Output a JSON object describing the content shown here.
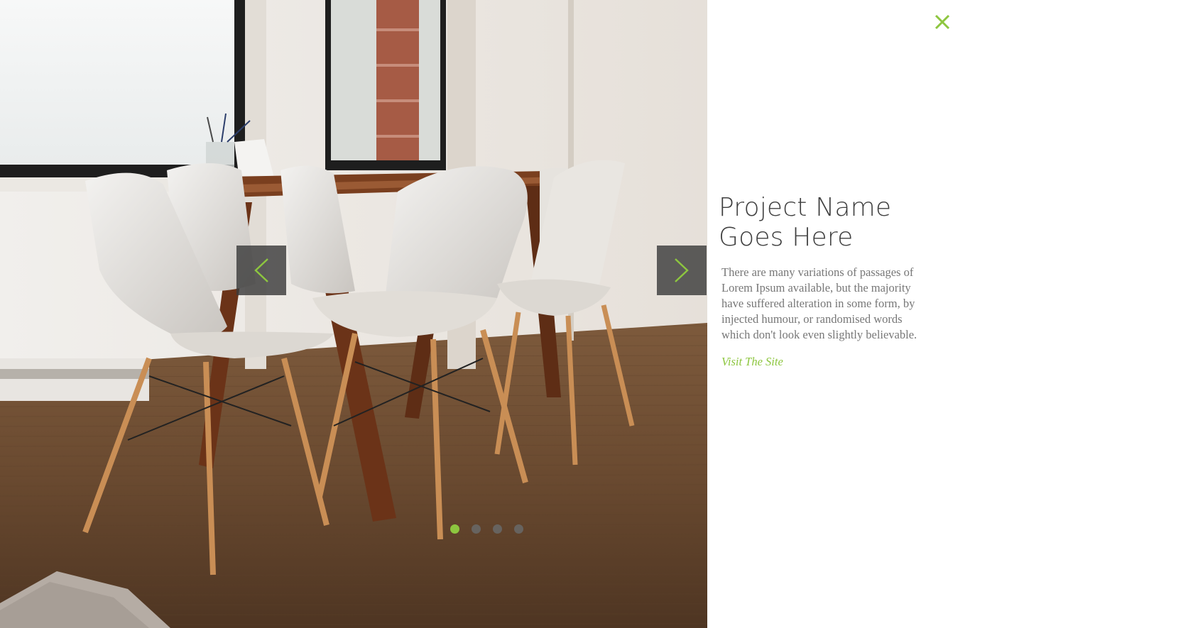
{
  "slider": {
    "image_alt": "Dining table with white shell chairs in a bright room",
    "prev_icon": "chevron-left-icon",
    "next_icon": "chevron-right-icon",
    "slides_total": 4,
    "active_slide": 1
  },
  "panel": {
    "close_icon": "close-icon",
    "title": "Project Name Goes Here",
    "description": "There are many variations of passages of Lorem Ipsum available, but the majority have suffered alteration in some form, by injected humour, or randomised words which don't look even slightly believable.",
    "link_label": "Visit The Site"
  },
  "colors": {
    "accent": "#8dc63f",
    "title": "#3f3f3f",
    "body": "#777777",
    "nav_bg": "#3c3c3c"
  }
}
